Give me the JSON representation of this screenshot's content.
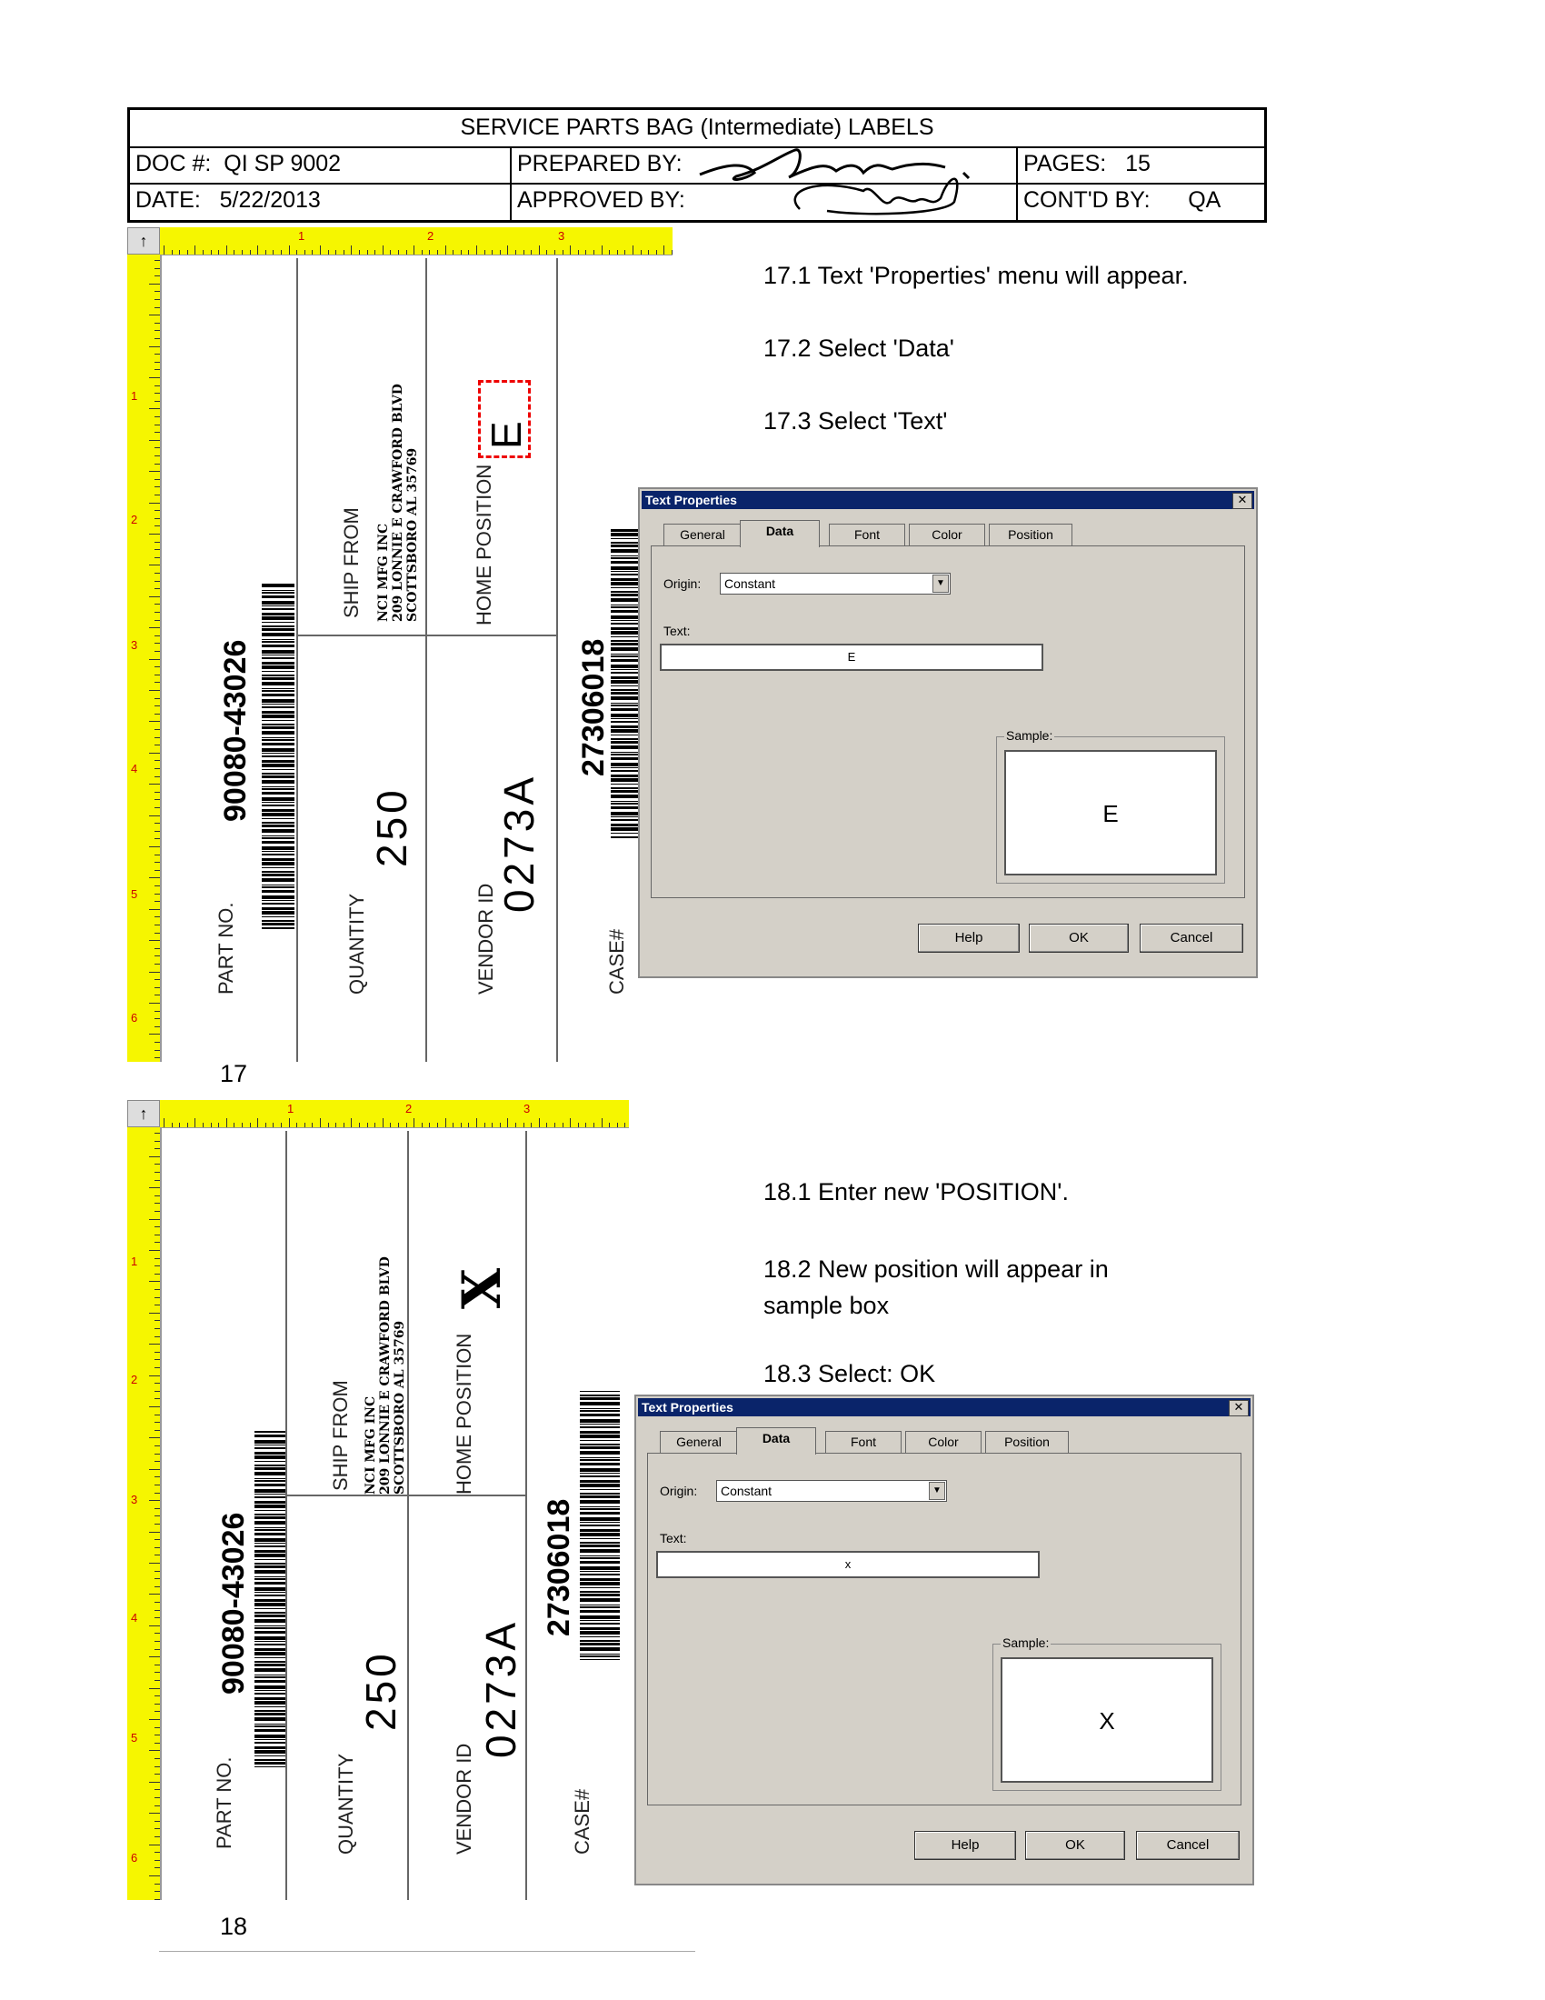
{
  "header": {
    "title": "SERVICE PARTS BAG (Intermediate) LABELS",
    "doc_label": "DOC #:",
    "doc_value": "QI SP 9002",
    "prepared_label": "PREPARED BY:",
    "pages_label": "PAGES:",
    "pages_value": "15",
    "date_label": "DATE:",
    "date_value": "5/22/2013",
    "approved_label": "APPROVED BY:",
    "contd_label": "CONT'D BY:",
    "contd_value": "QA"
  },
  "label": {
    "part_no": "90080-43026",
    "part_no_label": "PART NO.",
    "quantity": "250",
    "quantity_label": "QUANTITY",
    "ship_from_label": "SHIP FROM",
    "ship_from_lines": [
      "NCI MFG INC",
      "209 LONNIE E CRAWFORD BLVD",
      "SCOTTSBORO  AL  35769"
    ],
    "home_position_label": "HOME POSITION",
    "vendor_id": "0273A",
    "vendor_id_label": "VENDOR ID",
    "case_no": "27306018",
    "case_label": "CASE#",
    "ruler_numbers": [
      "1",
      "2",
      "3",
      "4",
      "5",
      "6"
    ]
  },
  "section17": {
    "caption": "17",
    "home_position_value": "E",
    "steps": [
      "17.1 Text 'Properties' menu will appear.",
      "17.2 Select 'Data'",
      "17.3 Select 'Text'"
    ],
    "dialog": {
      "title": "Text Properties",
      "tabs": [
        "General",
        "Data",
        "Font",
        "Color",
        "Position"
      ],
      "origin_label": "Origin:",
      "origin_value": "Constant",
      "text_label": "Text:",
      "text_value": "E",
      "sample_label": "Sample:",
      "sample_value": "E",
      "buttons": [
        "Help",
        "OK",
        "Cancel"
      ]
    }
  },
  "section18": {
    "caption": "18",
    "home_position_value": "X",
    "steps": [
      "18.1 Enter new 'POSITION'.",
      "18.2 New position will appear in sample box",
      "18.3 Select:  OK"
    ],
    "dialog": {
      "title": "Text Properties",
      "tabs": [
        "General",
        "Data",
        "Font",
        "Color",
        "Position"
      ],
      "origin_label": "Origin:",
      "origin_value": "Constant",
      "text_label": "Text:",
      "text_value": "x",
      "sample_label": "Sample:",
      "sample_value": "X",
      "buttons": [
        "Help",
        "OK",
        "Cancel"
      ]
    }
  }
}
